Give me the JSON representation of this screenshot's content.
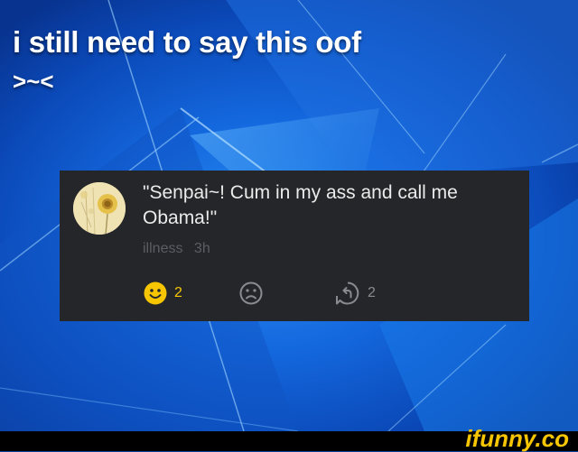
{
  "meme": {
    "headline": "i still need to say this oof",
    "emoticon": ">~<"
  },
  "comment": {
    "avatar_icon": "sunflower-avatar",
    "text": "\"Senpai~! Cum in my ass and call me Obama!\"",
    "author": "illness",
    "time": "3h",
    "smile_count": "2",
    "frown_count": "",
    "reply_count": "2",
    "colors": {
      "smile": "#f7c600",
      "icon_gray": "#8a8b90",
      "card_bg": "#25262a"
    }
  },
  "footer": {
    "logo_text": "ifunny.co"
  }
}
